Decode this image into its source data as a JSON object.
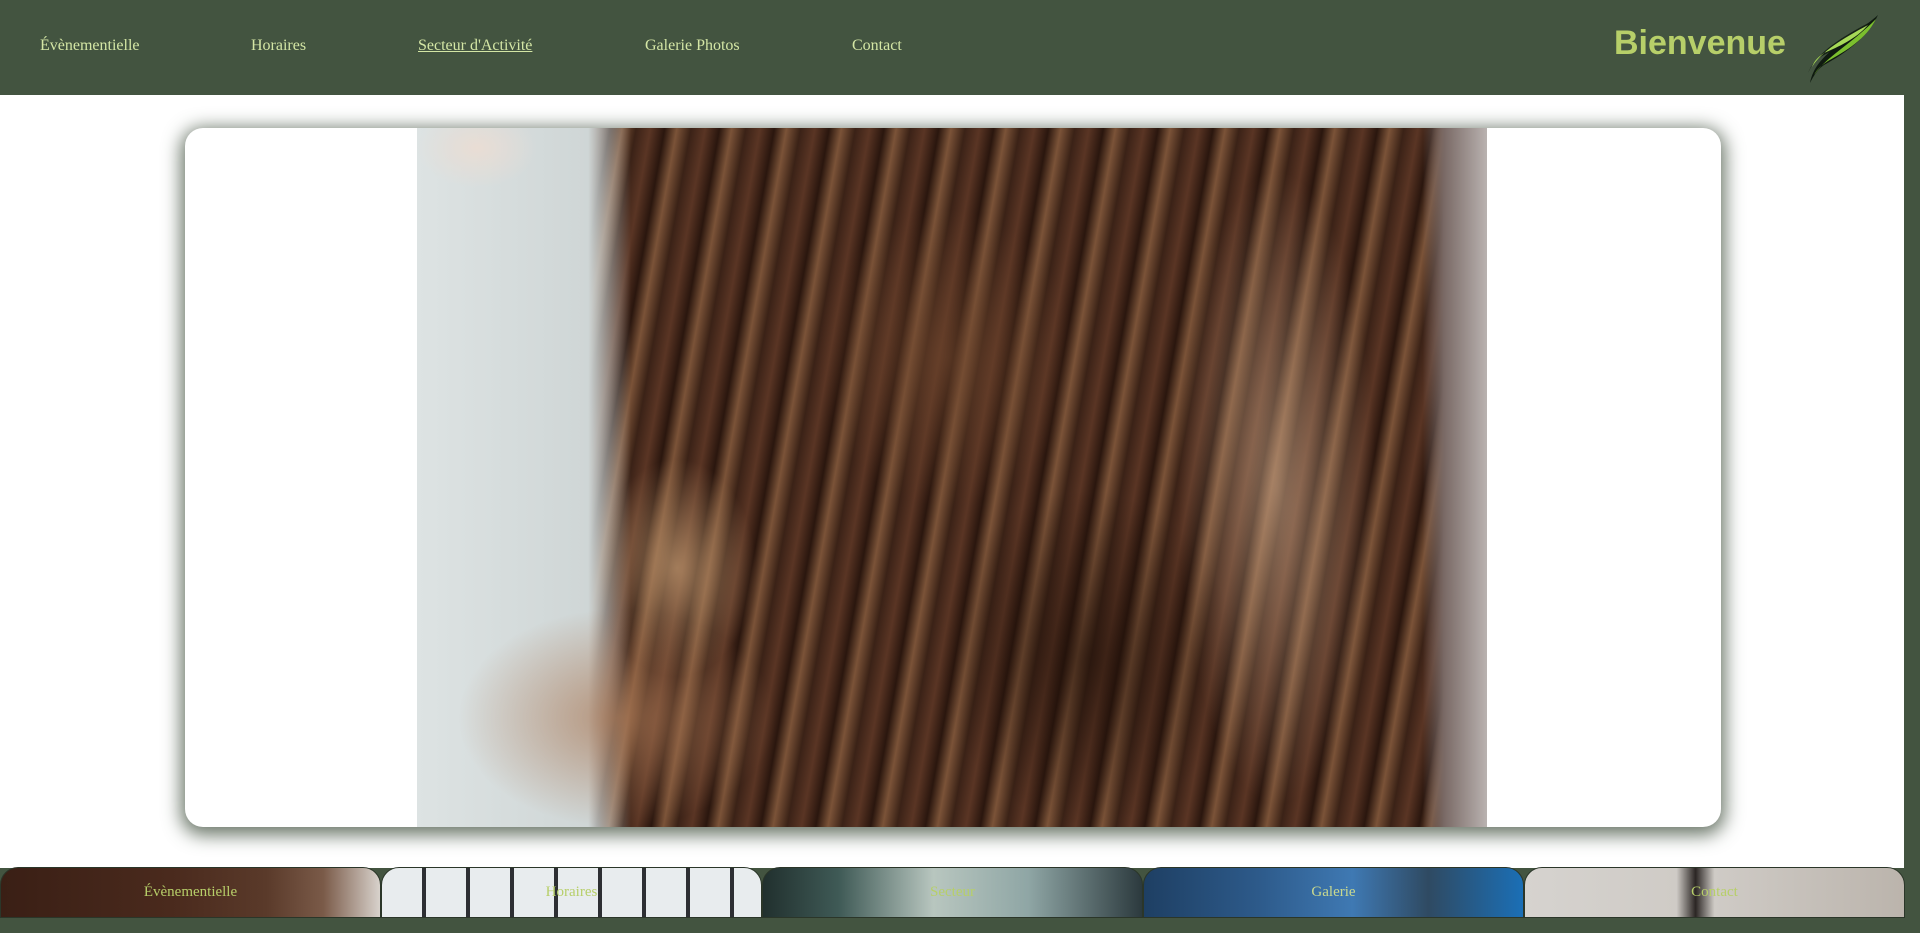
{
  "nav": {
    "items": [
      {
        "label": "Évènementielle",
        "active": false
      },
      {
        "label": "Horaires",
        "active": false
      },
      {
        "label": "Secteur d'Activité",
        "active": true
      },
      {
        "label": "Galerie Photos",
        "active": false
      },
      {
        "label": "Contact",
        "active": false
      }
    ]
  },
  "header": {
    "brand": "Bienvenue",
    "logo_icon": "green-leaf-swoosh-icon"
  },
  "hero": {
    "image_icon": "hair-curls-photo"
  },
  "strip": {
    "items": [
      {
        "label": "Évènementielle"
      },
      {
        "label": "Horaires"
      },
      {
        "label": "Secteur"
      },
      {
        "label": "Galerie"
      },
      {
        "label": "Contact"
      }
    ]
  },
  "colors": {
    "header_bg": "#435440",
    "nav_text": "#d4e6a5",
    "brand_text": "#b7cf69",
    "page_bg": "#ffffff"
  }
}
